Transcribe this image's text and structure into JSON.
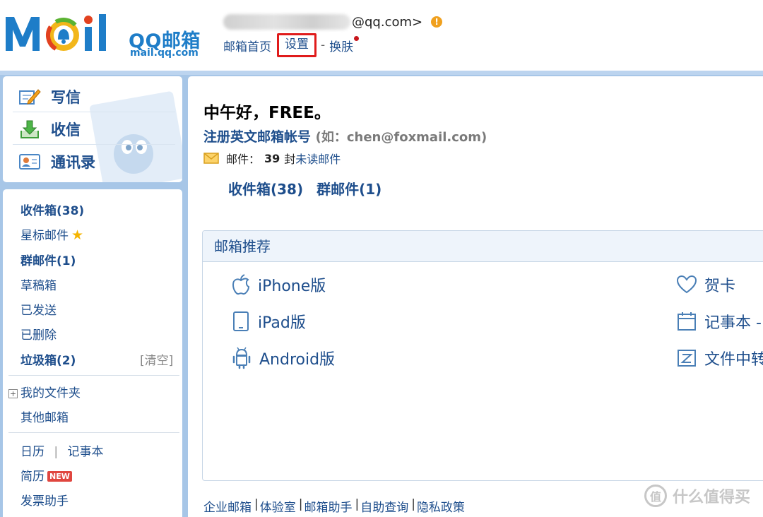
{
  "header": {
    "logo_text": "Mail",
    "logo_brand": "QQ邮箱",
    "logo_domain": "mail.qq.com",
    "account_suffix": "@qq.com>",
    "links": {
      "home": "邮箱首页",
      "settings": "设置",
      "separator": "-",
      "skin": "换肤"
    }
  },
  "toolbar": {
    "compose": "写信",
    "receive": "收信",
    "contacts": "通讯录"
  },
  "folders": {
    "inbox": "收件箱(38)",
    "starred": "星标邮件",
    "group": "群邮件(1)",
    "drafts": "草稿箱",
    "sent": "已发送",
    "deleted": "已删除",
    "spam": "垃圾箱(2)",
    "clear": "[清空]",
    "my_folders": "我的文件夹",
    "other_mail": "其他邮箱",
    "calendar": "日历",
    "divider": "|",
    "notepad": "记事本",
    "resume": "简历",
    "resume_badge": "NEW",
    "invoice": "发票助手"
  },
  "main": {
    "greeting": "中午好，FREE。",
    "register_text": "注册英文邮箱帐号",
    "register_hint": "(如：chen@foxmail.com)",
    "mail_label": "邮件：",
    "mail_count": "39",
    "mail_unit": "封",
    "unread_label": "未读邮件",
    "inbox_link": "收件箱(38)",
    "group_link": "群邮件(1)",
    "recommend_title": "邮箱推荐",
    "recommend": {
      "iphone": "iPhone版",
      "ipad": "iPad版",
      "android": "Android版",
      "card": "贺卡",
      "notepad": "记事本 -",
      "transfer": "文件中转"
    }
  },
  "footer": {
    "enterprise": "企业邮箱",
    "lab": "体验室",
    "helper": "邮箱助手",
    "self_query": "自助查询",
    "privacy": "隐私政策",
    "sep": "|"
  },
  "watermark": {
    "glyph": "值",
    "text": "什么值得买"
  },
  "colors": {
    "link_blue": "#1e4e8c",
    "frame_blue": "#a7c6e7",
    "highlight_red": "#e01b1b",
    "warning_orange": "#f0a01e"
  }
}
